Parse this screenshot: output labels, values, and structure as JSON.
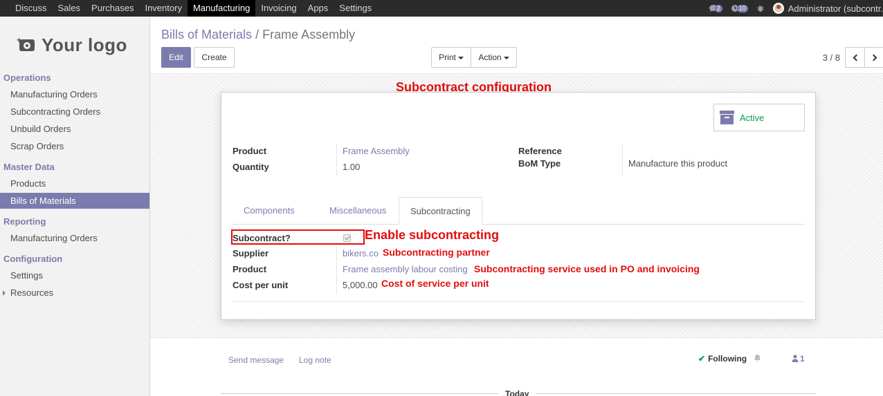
{
  "topbar": {
    "menu": [
      "Discuss",
      "Sales",
      "Purchases",
      "Inventory",
      "Manufacturing",
      "Invoicing",
      "Apps",
      "Settings"
    ],
    "active_menu": "Manufacturing",
    "chat_badge": "2",
    "activity_badge": "10",
    "user": "Administrator (subcontr."
  },
  "sidebar": {
    "logo_text": "Your logo",
    "sections": [
      {
        "heading": "Operations",
        "items": [
          "Manufacturing Orders",
          "Subcontracting Orders",
          "Unbuild Orders",
          "Scrap Orders"
        ]
      },
      {
        "heading": "Master Data",
        "items": [
          "Products",
          "Bills of Materials"
        ]
      },
      {
        "heading": "Reporting",
        "items": [
          "Manufacturing Orders"
        ]
      },
      {
        "heading": "Configuration",
        "items": [
          "Settings",
          "Resources"
        ]
      }
    ],
    "active_item": "Bills of Materials"
  },
  "control_panel": {
    "breadcrumb_parent": "Bills of Materials",
    "breadcrumb_sep": "/",
    "breadcrumb_current": "Frame Assembly",
    "edit_label": "Edit",
    "create_label": "Create",
    "print_label": "Print",
    "action_label": "Action",
    "pager": "3 / 8"
  },
  "form": {
    "status_label": "Active",
    "product_label": "Product",
    "product_value": "Frame Assembly",
    "quantity_label": "Quantity",
    "quantity_value": "1.00",
    "reference_label": "Reference",
    "bom_type_label": "BoM Type",
    "bom_type_value": "Manufacture this product",
    "tabs": [
      "Components",
      "Miscellaneous",
      "Subcontracting"
    ],
    "active_tab": "Subcontracting",
    "subcontract_label": "Subcontract?",
    "subcontract_checked": true,
    "supplier_label": "Supplier",
    "supplier_value": "bikers.co",
    "service_product_label": "Product",
    "service_product_value": "Frame assembly labour costing",
    "cost_label": "Cost per unit",
    "cost_value": "5,000.00"
  },
  "annotations": {
    "title": "Subcontract configuration",
    "enable": "Enable subcontracting",
    "partner": "Subcontracting partner",
    "service": "Subcontracting service used in PO and invoicing",
    "cost": "Cost of service per unit",
    "color": "#e30d0d"
  },
  "chatter": {
    "send_message": "Send message",
    "log_note": "Log note",
    "following": "Following",
    "followers_count": "1",
    "today": "Today"
  },
  "colors": {
    "brand": "#7c7bad",
    "topbar": "#2b2b2b",
    "active_green": "#00a04a"
  }
}
